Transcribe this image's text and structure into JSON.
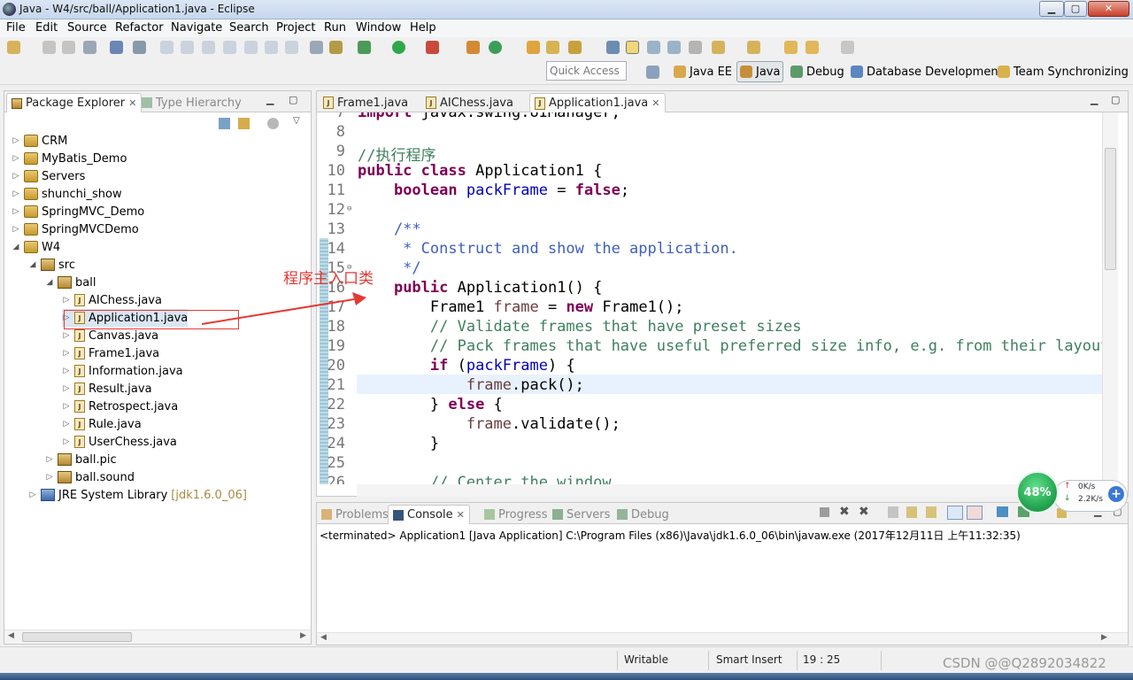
{
  "window": {
    "title": "Java - W4/src/ball/Application1.java - Eclipse",
    "controls": [
      "▁",
      "▢",
      "✕"
    ]
  },
  "menu": [
    "File",
    "Edit",
    "Source",
    "Refactor",
    "Navigate",
    "Search",
    "Project",
    "Run",
    "Window",
    "Help"
  ],
  "perspective_bar": {
    "quick_access": "Quick Access",
    "perspectives": [
      "Java EE",
      "Java",
      "Debug",
      "Database Development",
      "Team Synchronizing"
    ],
    "active": "Java"
  },
  "package_explorer": {
    "tabs": [
      "Package Explorer",
      "Type Hierarchy"
    ],
    "tree": [
      {
        "label": "CRM",
        "icon": "project-icon",
        "expanded": false
      },
      {
        "label": "MyBatis_Demo",
        "icon": "project-icon",
        "expanded": false
      },
      {
        "label": "Servers",
        "icon": "folder-icon",
        "expanded": false
      },
      {
        "label": "shunchi_show",
        "icon": "project-icon",
        "expanded": false
      },
      {
        "label": "SpringMVC_Demo",
        "icon": "project-icon",
        "expanded": false
      },
      {
        "label": "SpringMVCDemo",
        "icon": "project-icon",
        "expanded": false
      },
      {
        "label": "W4",
        "icon": "project-icon",
        "expanded": true
      },
      {
        "label": "src",
        "icon": "source-folder-icon",
        "expanded": true
      },
      {
        "label": "ball",
        "icon": "package-icon",
        "expanded": true
      },
      {
        "label": "AIChess.java",
        "icon": "java-file-icon",
        "expanded": false
      },
      {
        "label": "Application1.java",
        "icon": "java-file-icon",
        "expanded": false,
        "selected": true
      },
      {
        "label": "Canvas.java",
        "icon": "java-file-icon",
        "expanded": false
      },
      {
        "label": "Frame1.java",
        "icon": "java-file-icon",
        "expanded": false
      },
      {
        "label": "Information.java",
        "icon": "java-file-icon",
        "expanded": false
      },
      {
        "label": "Result.java",
        "icon": "java-file-icon",
        "expanded": false
      },
      {
        "label": "Retrospect.java",
        "icon": "java-file-icon",
        "expanded": false
      },
      {
        "label": "Rule.java",
        "icon": "java-file-icon",
        "expanded": false
      },
      {
        "label": "UserChess.java",
        "icon": "java-file-icon",
        "expanded": false
      },
      {
        "label": "ball.pic",
        "icon": "package-icon",
        "expanded": false
      },
      {
        "label": "ball.sound",
        "icon": "package-icon",
        "expanded": false
      },
      {
        "label": "JRE System Library",
        "icon": "library-icon",
        "expanded": false,
        "suffix": "[jdk1.6.0_06]"
      }
    ]
  },
  "editor": {
    "tabs": [
      "Frame1.java",
      "AIChess.java",
      "Application1.java"
    ],
    "active_tab": "Application1.java",
    "lines": [
      {
        "n": "7",
        "text": "import javax.swing.UIManager;"
      },
      {
        "n": "8",
        "text": ""
      },
      {
        "n": "9",
        "text": "//执行程序"
      },
      {
        "n": "10",
        "text": "public class Application1 {"
      },
      {
        "n": "11",
        "text": "    boolean packFrame = false;"
      },
      {
        "n": "12",
        "text": ""
      },
      {
        "n": "13",
        "text": "    /**"
      },
      {
        "n": "14",
        "text": "     * Construct and show the application."
      },
      {
        "n": "15",
        "text": "     */"
      },
      {
        "n": "16",
        "text": "    public Application1() {"
      },
      {
        "n": "17",
        "text": "        Frame1 frame = new Frame1();"
      },
      {
        "n": "18",
        "text": "        // Validate frames that have preset sizes"
      },
      {
        "n": "19",
        "text": "        // Pack frames that have useful preferred size info, e.g. from their layout"
      },
      {
        "n": "20",
        "text": "        if (packFrame) {"
      },
      {
        "n": "21",
        "text": "            frame.pack();"
      },
      {
        "n": "22",
        "text": "        } else {"
      },
      {
        "n": "23",
        "text": "            frame.validate();"
      },
      {
        "n": "24",
        "text": "        }"
      },
      {
        "n": "25",
        "text": ""
      },
      {
        "n": "26",
        "text": "        // Center the window"
      }
    ]
  },
  "console": {
    "tabs": [
      "Problems",
      "Console",
      "Progress",
      "Servers",
      "Debug"
    ],
    "active_tab": "Console",
    "header": "<terminated> Application1 [Java Application] C:\\Program Files (x86)\\Java\\jdk1.6.0_06\\bin\\javaw.exe (2017年12月11日 上午11:32:35)"
  },
  "status_bar": {
    "mode": "Writable",
    "insert_mode": "Smart Insert",
    "position": "19 : 25"
  },
  "annotation": {
    "label": "程序主入口类"
  },
  "net_widget": {
    "percent": "48%",
    "up": "0K/s",
    "down": "2.2K/s"
  },
  "watermark": "CSDN @@Q2892034822",
  "colors": {
    "keyword": "#7f0055",
    "field": "#0000c0",
    "comment": "#3f7f5f",
    "javadoc": "#3f5fbf",
    "annotation": "#e53935"
  }
}
